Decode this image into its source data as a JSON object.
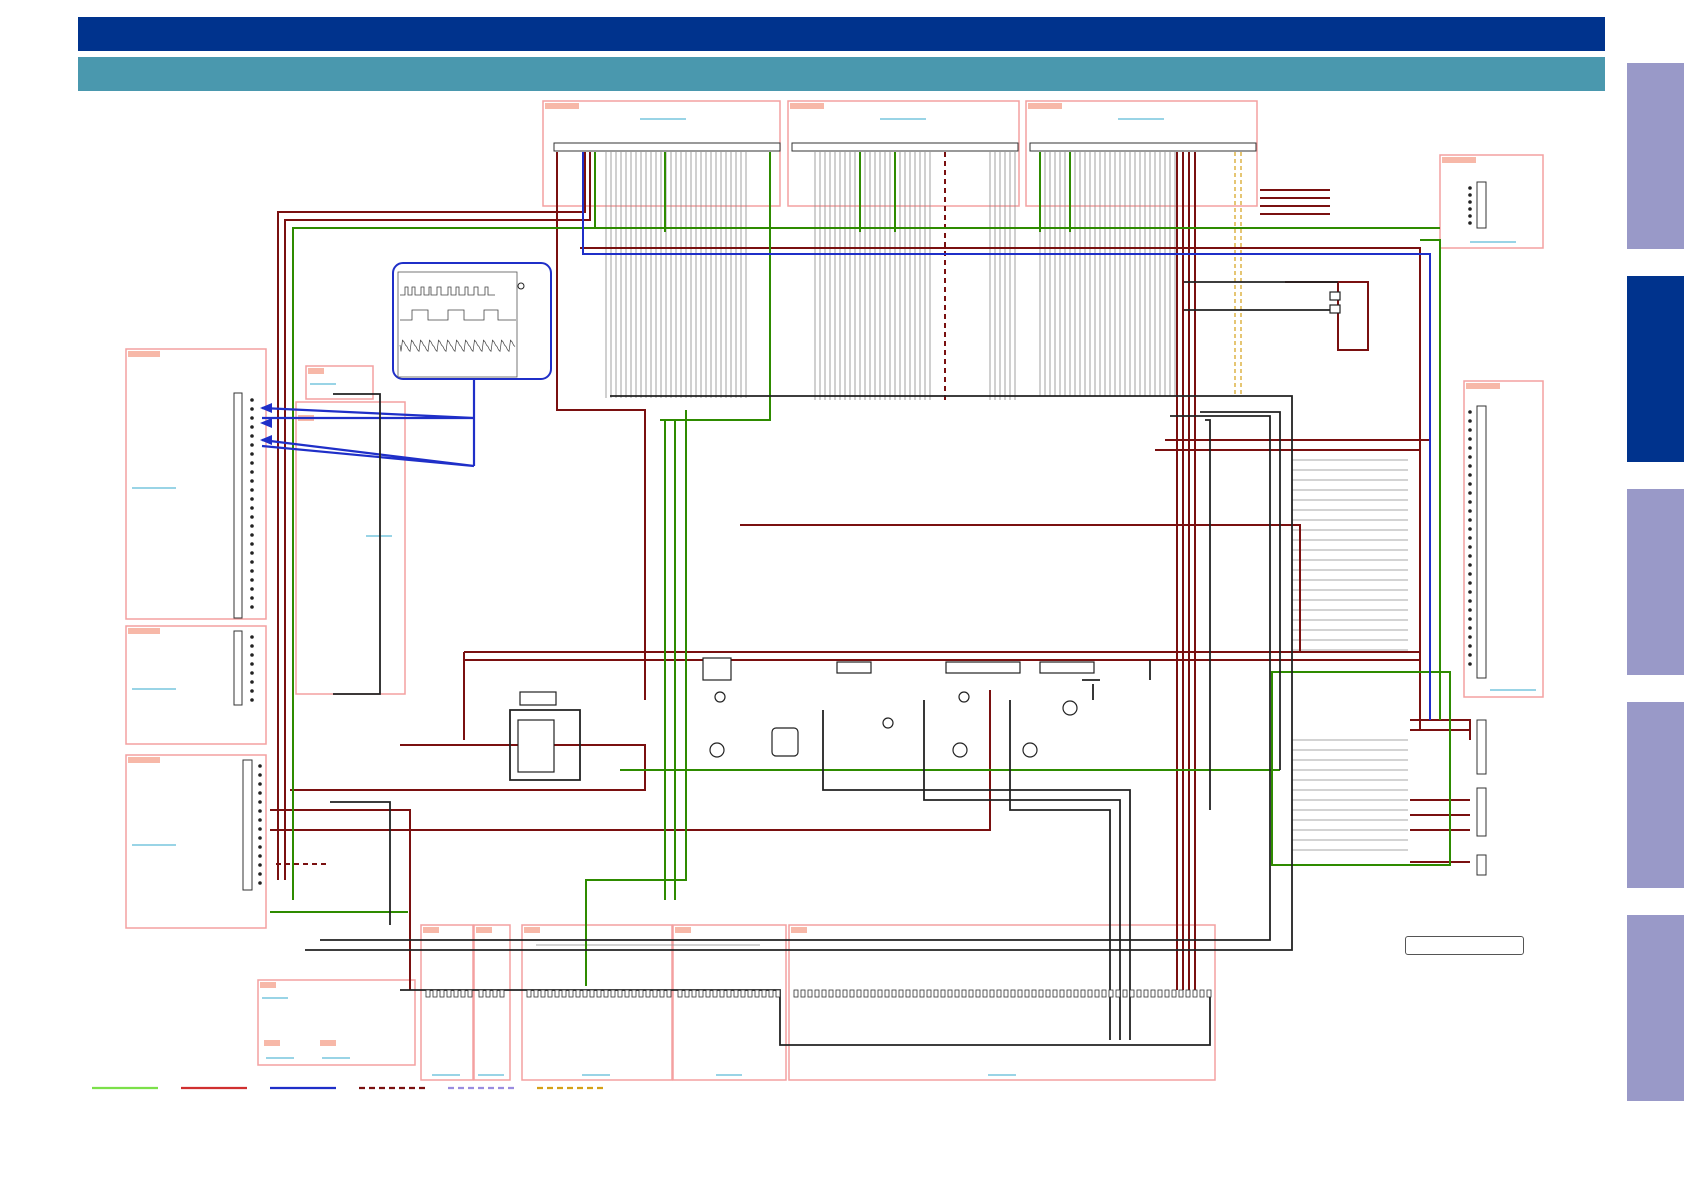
{
  "colors": {
    "header_bar": "#00338D",
    "sub_header_bar": "#4A98AE",
    "side_tab": "#9999C8",
    "side_tab_active": "#00338D",
    "block_border": "#F4A0A0",
    "block_tag": "#F7B8A8",
    "wire_red": "#7A1010",
    "wire_green": "#2E8B00",
    "wire_blue": "#1F2FC8",
    "wire_black": "#222222",
    "wire_gray": "#8A8A8A",
    "link_cyan": "#33AACC",
    "waveform_frame": "#1F2FC8"
  },
  "side_tabs": [
    {
      "id": "tab-1",
      "active": false
    },
    {
      "id": "tab-2",
      "active": true
    },
    {
      "id": "tab-3",
      "active": false
    },
    {
      "id": "tab-4",
      "active": false
    },
    {
      "id": "tab-5",
      "active": false
    }
  ],
  "legend": [
    {
      "color": "#7CE04A",
      "style": "solid"
    },
    {
      "color": "#D03030",
      "style": "solid"
    },
    {
      "color": "#1F2FC8",
      "style": "solid"
    },
    {
      "color": "#7A1010",
      "style": "dashed"
    },
    {
      "color": "#9A8CE0",
      "style": "dashed"
    },
    {
      "color": "#D4A017",
      "style": "dashed"
    }
  ],
  "icons": {
    "waveform": "oscilloscope-waveform-icon",
    "connector": "connector-pin-icon",
    "transistor": "transistor-icon",
    "ic": "integrated-circuit-icon"
  }
}
